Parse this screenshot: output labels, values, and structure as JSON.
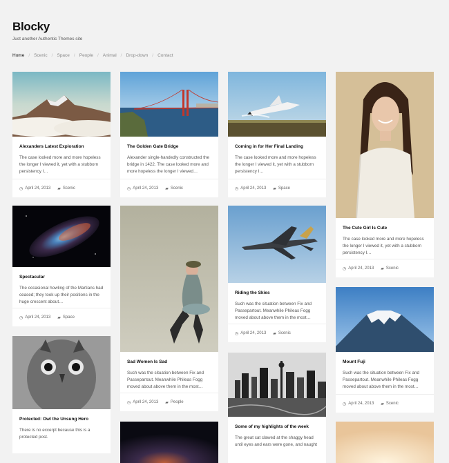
{
  "site": {
    "title": "Blocky",
    "tagline": "Just another Authentic Themes site"
  },
  "nav": {
    "items": [
      "Home",
      "Scenic",
      "Space",
      "People",
      "Animal",
      "Drop-down",
      "Contact"
    ],
    "separator": "/"
  },
  "posts": [
    {
      "title": "Alexanders Latest Exploration",
      "excerpt": "The case looked more and more hopeless the longer I viewed it, yet with a stubborn persistency I…",
      "date": "April 24, 2013",
      "category": "Scenic"
    },
    {
      "title": "The Golden Gate Bridge",
      "excerpt": "Alexander single-handedly constructed the bridge in 1422. The case looked more and more hopeless the longer I viewed…",
      "date": "April 24, 2013",
      "category": "Scenic"
    },
    {
      "title": "Coming in for Her Final Landing",
      "excerpt": "The case looked more and more hopeless the longer I viewed it, yet with a stubborn persistency I…",
      "date": "April 24, 2013",
      "category": "Space"
    },
    {
      "title": "The Cute Girl Is Cute",
      "excerpt": "The case looked more and more hopeless the longer I viewed it, yet with a stubborn persistency I…",
      "date": "April 24, 2013",
      "category": "Scenic"
    },
    {
      "title": "Spectacular",
      "excerpt": "The occasional howling of the Martians had ceased; they took up their positions in the huge crescent about…",
      "date": "April 24, 2013",
      "category": "Space"
    },
    {
      "title": "Sad Women Is Sad",
      "excerpt": "Such was the situation between Fix and Passepartout. Meanwhile Phileas Fogg moved about above them in the most…",
      "date": "April 24, 2013",
      "category": "People"
    },
    {
      "title": "Riding the Skies",
      "excerpt": "Such was the situation between Fix and Passepartout. Meanwhile Phileas Fogg moved about above them in the most…",
      "date": "April 24, 2013",
      "category": "Scenic"
    },
    {
      "title": "Mount Fuji",
      "excerpt": "Such was the situation between Fix and Passepartout. Meanwhile Phileas Fogg moved about above them in the most…",
      "date": "April 24, 2013",
      "category": "Scenic"
    },
    {
      "title": "Protected: Owl the Unsung Hero",
      "excerpt": "There is no excerpt because this is a protected post."
    },
    {
      "title": "Some of my highlights of the week",
      "excerpt": "The great cat clawed at the shaggy head until eyes and ears were gone, and naught"
    }
  ],
  "icons": {
    "date": "clock-icon",
    "category": "folder-icon"
  }
}
